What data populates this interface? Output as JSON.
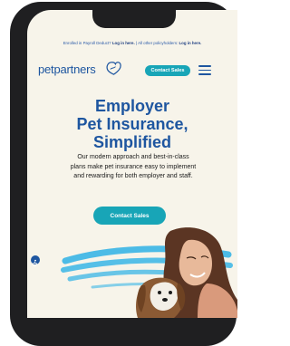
{
  "notice": {
    "prefix": "Enrolled in Payroll Deduct?",
    "login1": "Log in here.",
    "middle": "| All other policyholders:",
    "login2": "Log in here."
  },
  "header": {
    "logo_text": "petpartners",
    "contact_label": "Contact Sales",
    "menu_icon": "hamburger-menu-icon"
  },
  "hero": {
    "title_lines": [
      "Employer",
      "Pet Insurance,",
      "Simplified"
    ],
    "body_lines": [
      "Our modern approach and best-in-class",
      "plans make pet insurance easy to implement",
      "and rewarding for both employer and staff."
    ],
    "cta_label": "Contact Sales"
  },
  "accessibility": {
    "icon": "accessibility-icon"
  },
  "colors": {
    "brand_blue": "#1e56a0",
    "accent_teal": "#18a5b7",
    "background": "#f7f4ea",
    "brush_stroke": "#38b5e6"
  }
}
